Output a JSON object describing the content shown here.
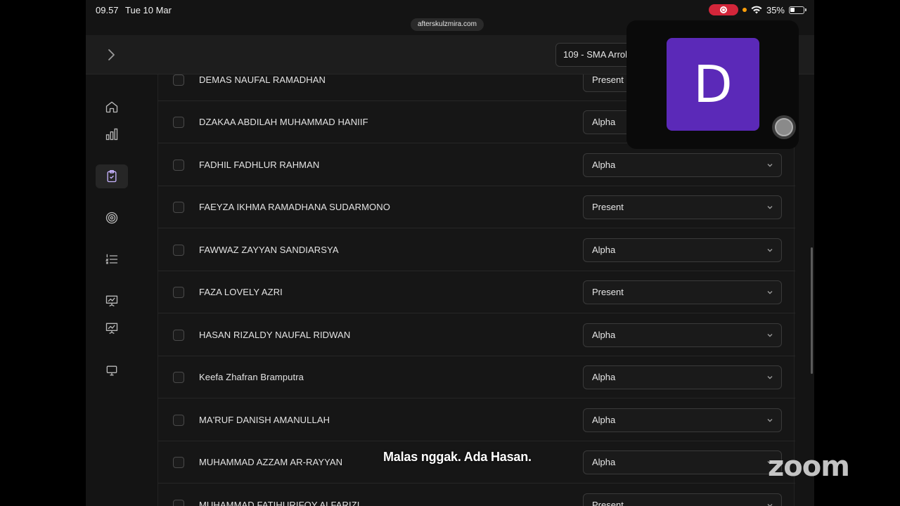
{
  "status_bar": {
    "time": "09.57",
    "date": "Tue 10 Mar",
    "battery": "35%"
  },
  "browser": {
    "url": "afterskulzmira.com"
  },
  "header": {
    "school_select": "109 - SMA Arrol"
  },
  "sidebar": {
    "items": [
      {
        "icon": "home-icon",
        "active": false
      },
      {
        "icon": "bar-chart-icon",
        "active": false
      },
      {
        "icon": "clipboard-check-icon",
        "active": true
      },
      {
        "icon": "target-icon",
        "active": false
      },
      {
        "icon": "numbered-list-icon",
        "active": false
      },
      {
        "icon": "presentation-chart-icon",
        "active": false
      },
      {
        "icon": "presentation-chart-icon",
        "active": false
      },
      {
        "icon": "monitor-icon",
        "active": false
      }
    ]
  },
  "attendance": {
    "rows": [
      {
        "name": "DEMAS NAUFAL RAMADHAN",
        "status": "Present"
      },
      {
        "name": "DZAKAA ABDILAH MUHAMMAD HANIIF",
        "status": "Alpha"
      },
      {
        "name": "FADHIL FADHLUR RAHMAN",
        "status": "Alpha"
      },
      {
        "name": "FAEYZA IKHMA RAMADHANA SUDARMONO",
        "status": "Present"
      },
      {
        "name": "FAWWAZ ZAYYAN SANDIARSYA",
        "status": "Alpha"
      },
      {
        "name": "FAZA LOVELY AZRI",
        "status": "Present"
      },
      {
        "name": "HASAN RIZALDY NAUFAL RIDWAN",
        "status": "Alpha"
      },
      {
        "name": "Keefa Zhafran Bramputra",
        "status": "Alpha"
      },
      {
        "name": "MA'RUF DANISH AMANULLAH",
        "status": "Alpha"
      },
      {
        "name": "MUHAMMAD AZZAM AR-RAYYAN",
        "status": "Alpha"
      },
      {
        "name": "MUHAMMAD FATIHURIFQY ALFARIZI",
        "status": "Present"
      }
    ]
  },
  "zoom": {
    "participant_initial": "D",
    "caption": "Malas nggak. Ada Hasan.",
    "logo": "zoom"
  },
  "colors": {
    "accent": "#5b29b8",
    "recording": "#d3263a"
  }
}
